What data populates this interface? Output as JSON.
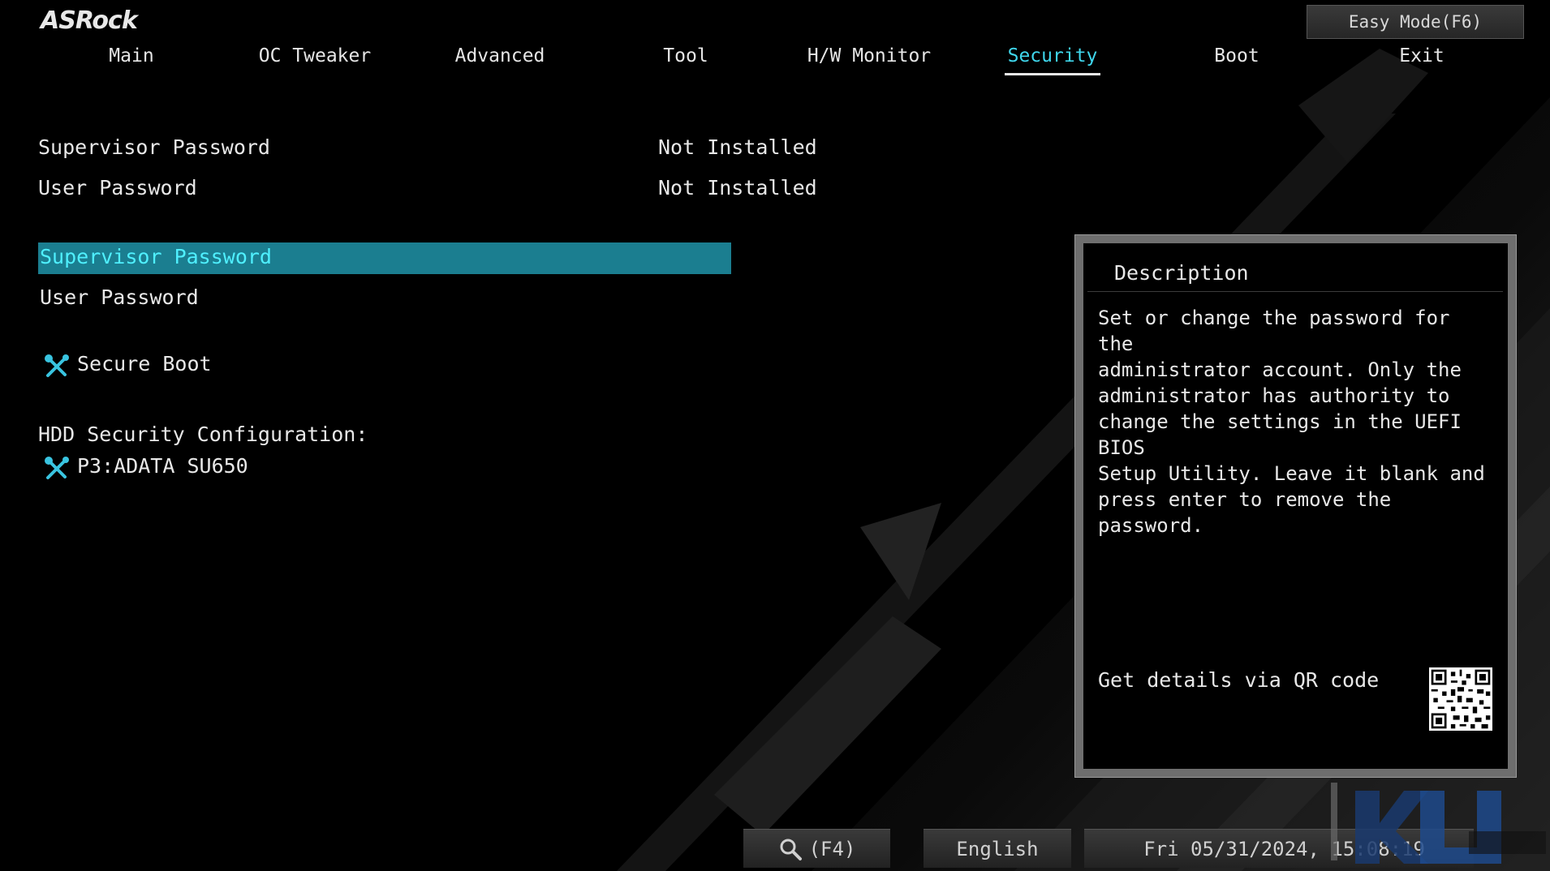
{
  "header": {
    "logo": "ASRock",
    "easy_mode_label": "Easy Mode(F6)"
  },
  "tabs": [
    {
      "label": "Main",
      "active": false
    },
    {
      "label": "OC Tweaker",
      "active": false
    },
    {
      "label": "Advanced",
      "active": false
    },
    {
      "label": "Tool",
      "active": false
    },
    {
      "label": "H/W Monitor",
      "active": false
    },
    {
      "label": "Security",
      "active": true
    },
    {
      "label": "Boot",
      "active": false
    },
    {
      "label": "Exit",
      "active": false
    }
  ],
  "status": [
    {
      "label": "Supervisor Password",
      "value": "Not Installed"
    },
    {
      "label": "User Password",
      "value": "Not Installed"
    }
  ],
  "menu": {
    "supervisor_password": "Supervisor Password",
    "user_password": "User Password",
    "secure_boot": "Secure Boot",
    "hdd_heading": "HDD Security Configuration:",
    "hdd_device": "P3:ADATA SU650"
  },
  "description": {
    "title": "Description",
    "body": "Set or change the password for the\nadministrator account. Only the\nadministrator has authority to\nchange the settings in the UEFI BIOS\nSetup Utility. Leave it blank and\npress enter to remove the password.",
    "qr_label": "Get details via QR code"
  },
  "bottom": {
    "search_label": "(F4)",
    "language": "English",
    "datetime": "Fri 05/31/2024, 15:08:19"
  },
  "colors": {
    "accent": "#3fd6ec",
    "selection": "#1b7e90",
    "background": "#000000"
  },
  "icons": {
    "tool": "wrench-screwdriver-icon",
    "search": "magnifier-icon"
  }
}
